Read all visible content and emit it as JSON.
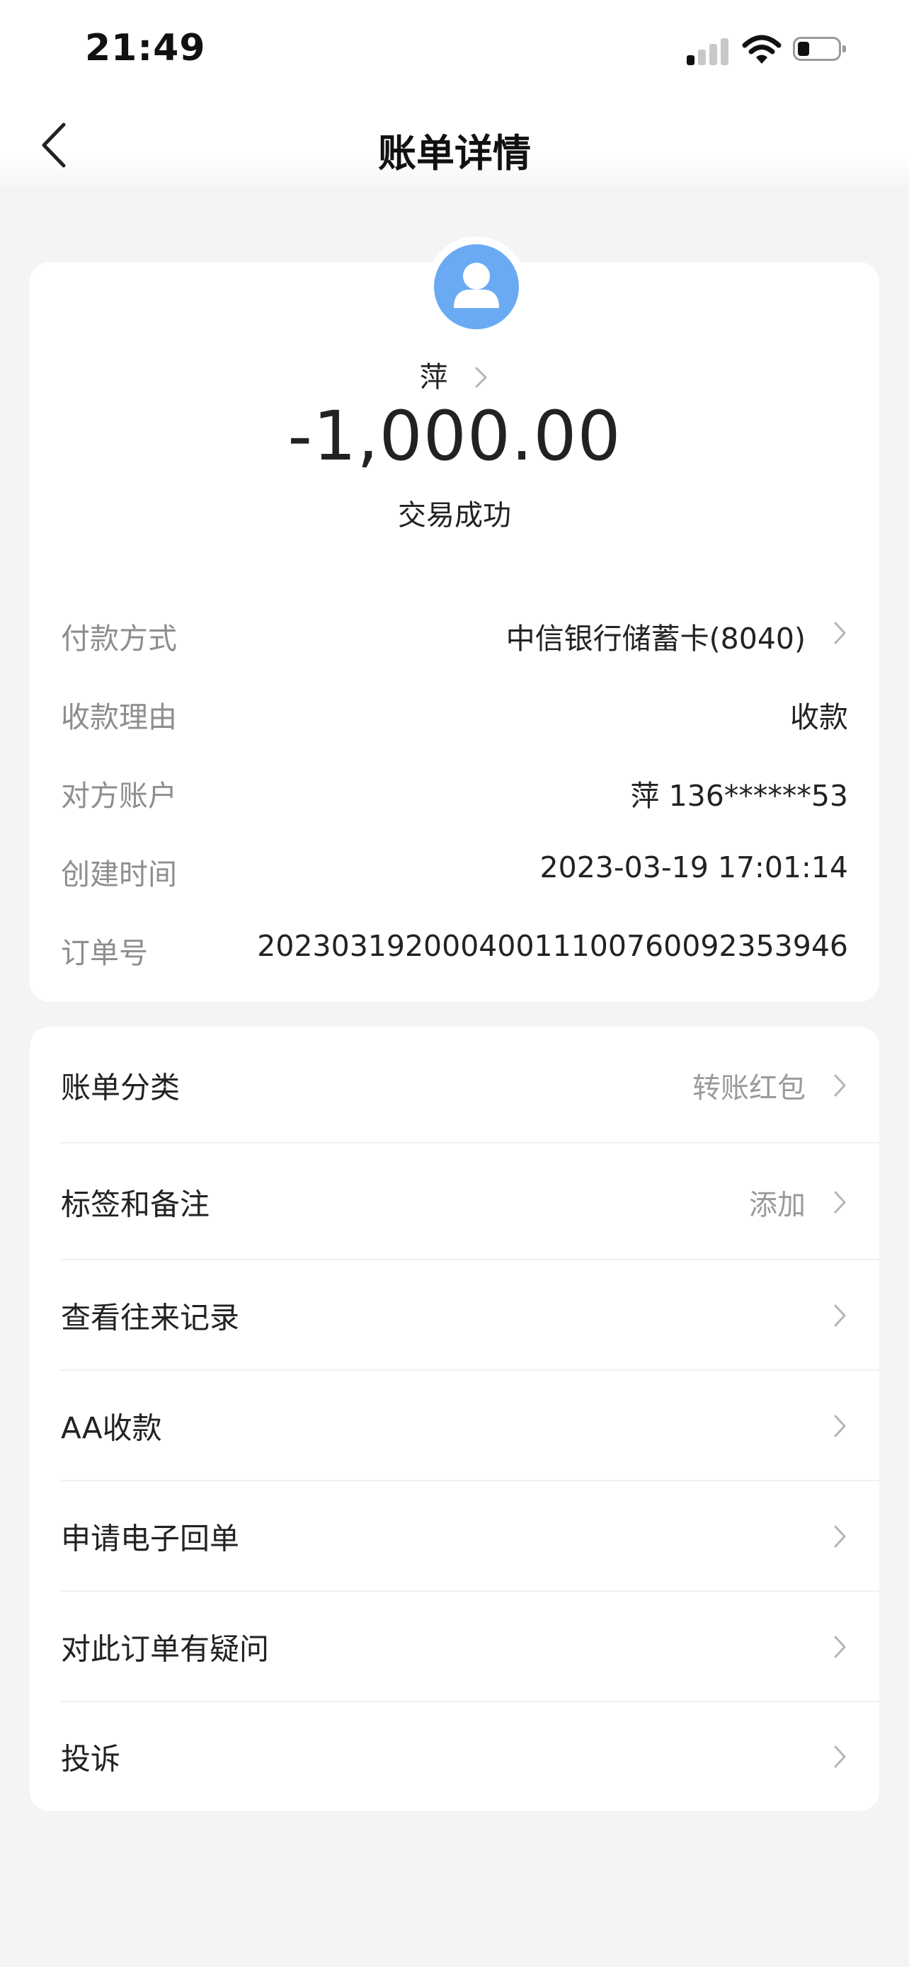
{
  "status_bar": {
    "time": "21:49"
  },
  "nav": {
    "title": "账单详情"
  },
  "summary": {
    "payee": "萍",
    "amount": "-1,000.00",
    "status": "交易成功"
  },
  "details": [
    {
      "label": "付款方式",
      "value": "中信银行储蓄卡(8040)"
    },
    {
      "label": "收款理由",
      "value": "收款"
    },
    {
      "label": "对方账户",
      "value": "萍 136******53"
    },
    {
      "label": "创建时间",
      "value": "2023-03-19 17:01:14"
    },
    {
      "label": "订单号",
      "value": "20230319200040011100760092353946"
    }
  ],
  "menu": [
    {
      "label": "账单分类",
      "value": "转账红包"
    },
    {
      "label": "标签和备注",
      "value": "添加"
    },
    {
      "label": "查看往来记录",
      "value": ""
    },
    {
      "label": "AA收款",
      "value": ""
    },
    {
      "label": "申请电子回单",
      "value": ""
    },
    {
      "label": "对此订单有疑问",
      "value": ""
    },
    {
      "label": "投诉",
      "value": ""
    }
  ],
  "colors": {
    "avatar": "#6aaaf3",
    "background": "#f4f4f4",
    "muted_text": "#8e8e8e"
  },
  "icons": [
    "back-arrow-icon",
    "chevron-right-icon",
    "person-icon",
    "signal-icon",
    "wifi-icon",
    "battery-icon"
  ]
}
